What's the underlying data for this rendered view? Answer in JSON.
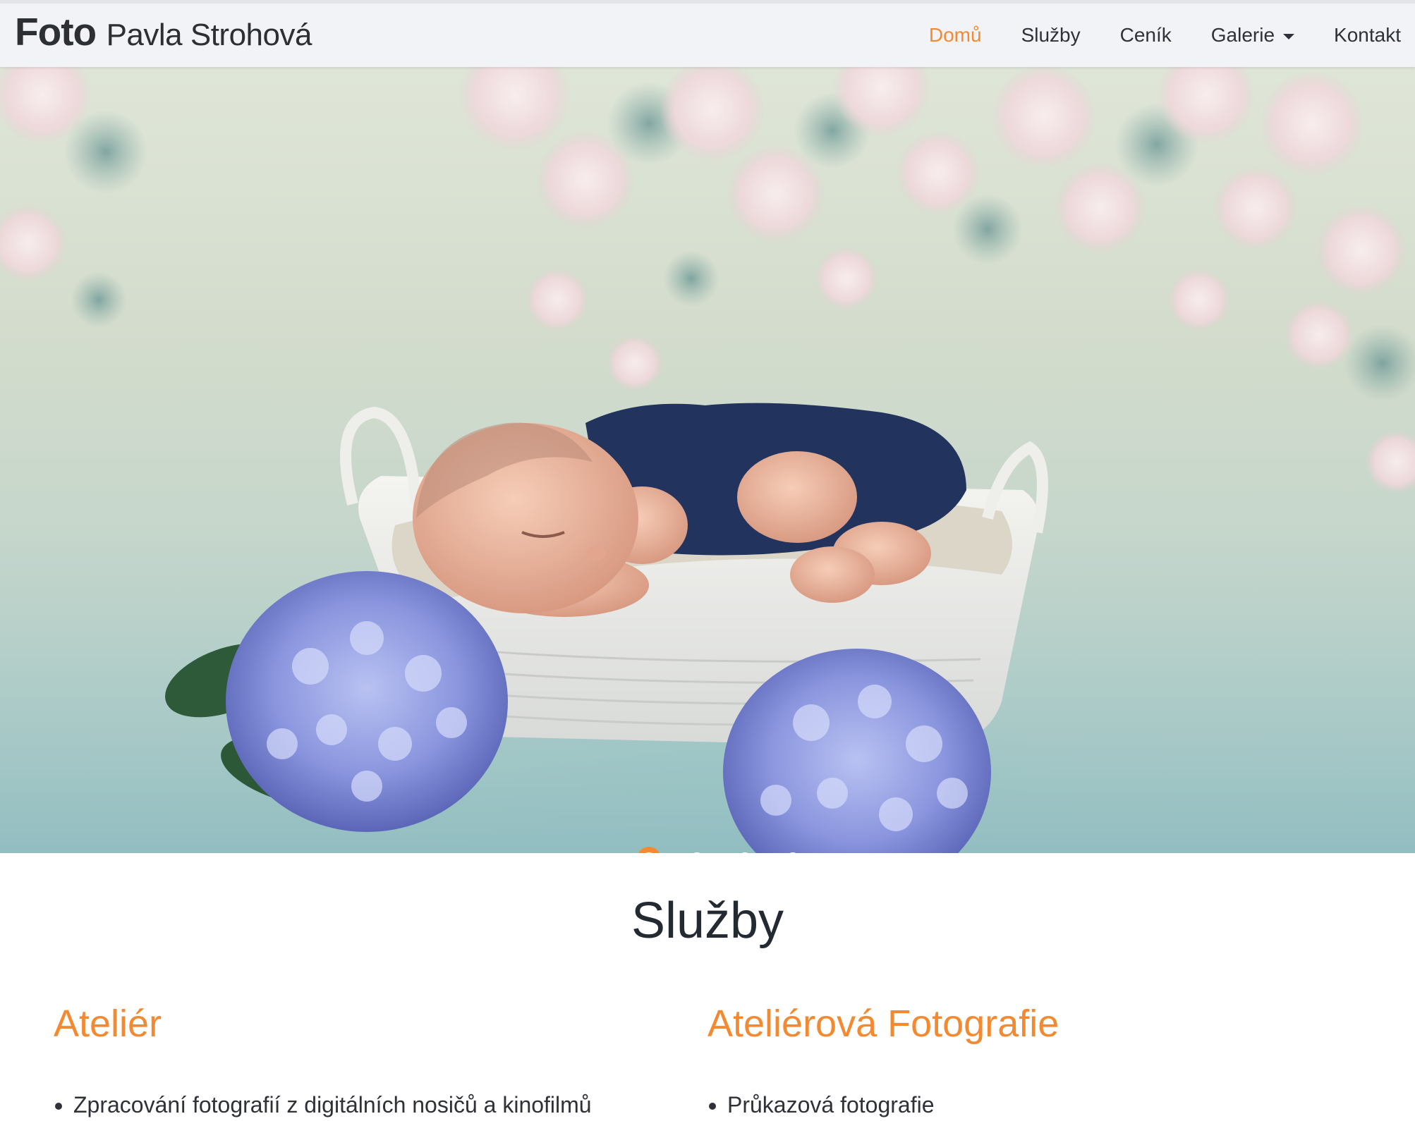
{
  "brand": {
    "bold": "Foto",
    "light": "Pavla Strohová"
  },
  "nav": {
    "items": [
      {
        "label": "Domů",
        "active": true
      },
      {
        "label": "Služby"
      },
      {
        "label": "Ceník"
      },
      {
        "label": "Galerie",
        "dropdown": true
      },
      {
        "label": "Kontakt"
      }
    ]
  },
  "hero": {
    "image": "newborn baby sleeping in white wicker basket with blue hydrangeas, floral backdrop",
    "slide_count": 4,
    "active_slide": 1
  },
  "services": {
    "title": "Služby",
    "columns": [
      {
        "title": "Ateliér",
        "items": [
          "Zpracování fotografií z digitálních nosičů a kinofilmů"
        ]
      },
      {
        "title": "Ateliérová Fotografie",
        "items": [
          "Průkazová fotografie"
        ]
      }
    ]
  },
  "colors": {
    "accent": "#f38a32",
    "navbar_bg": "#f2f3f7",
    "text": "#222a33"
  }
}
